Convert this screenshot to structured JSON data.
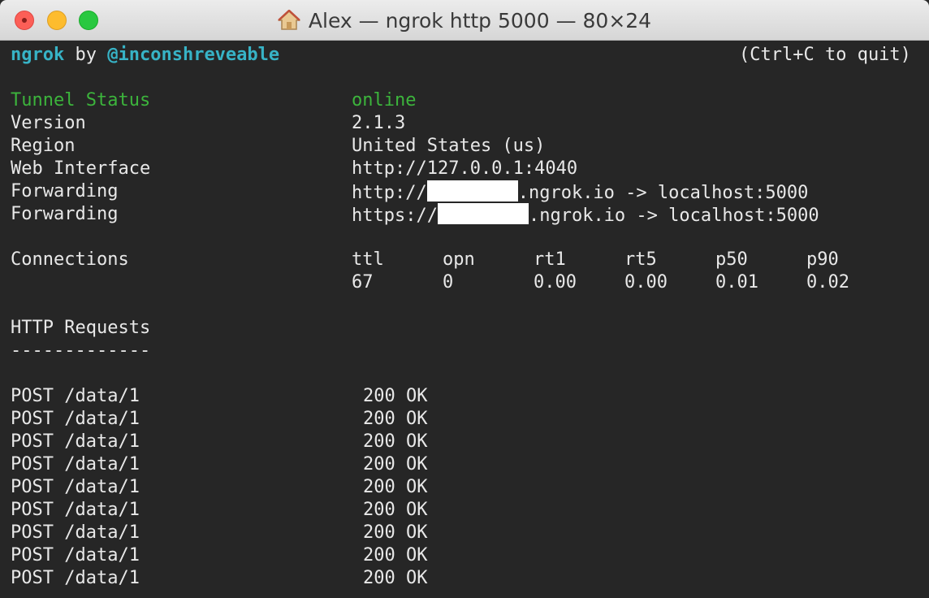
{
  "window": {
    "title": "Alex — ngrok http 5000 — 80×24"
  },
  "header": {
    "brand": "ngrok",
    "by": "by",
    "author": "@inconshreveable",
    "quit_hint": "(Ctrl+C to quit)"
  },
  "status": {
    "tunnel_label": "Tunnel Status",
    "tunnel_value": "online",
    "version_label": "Version",
    "version_value": "2.1.3",
    "region_label": "Region",
    "region_value": "United States (us)",
    "web_label": "Web Interface",
    "web_value": "http://127.0.0.1:4040",
    "fwd1_label": "Forwarding",
    "fwd1_prefix": "http://",
    "fwd1_suffix": ".ngrok.io -> localhost:5000",
    "fwd2_label": "Forwarding",
    "fwd2_prefix": "https://",
    "fwd2_suffix": ".ngrok.io -> localhost:5000"
  },
  "connections": {
    "label": "Connections",
    "headers": [
      "ttl",
      "opn",
      "rt1",
      "rt5",
      "p50",
      "p90"
    ],
    "values": [
      "67",
      "0",
      "0.00",
      "0.00",
      "0.01",
      "0.02"
    ]
  },
  "requests": {
    "title": "HTTP Requests",
    "divider": "-------------",
    "rows": [
      {
        "method_path": "POST /data/1",
        "status": "200 OK"
      },
      {
        "method_path": "POST /data/1",
        "status": "200 OK"
      },
      {
        "method_path": "POST /data/1",
        "status": "200 OK"
      },
      {
        "method_path": "POST /data/1",
        "status": "200 OK"
      },
      {
        "method_path": "POST /data/1",
        "status": "200 OK"
      },
      {
        "method_path": "POST /data/1",
        "status": "200 OK"
      },
      {
        "method_path": "POST /data/1",
        "status": "200 OK"
      },
      {
        "method_path": "POST /data/1",
        "status": "200 OK"
      },
      {
        "method_path": "POST /data/1",
        "status": "200 OK"
      }
    ]
  }
}
